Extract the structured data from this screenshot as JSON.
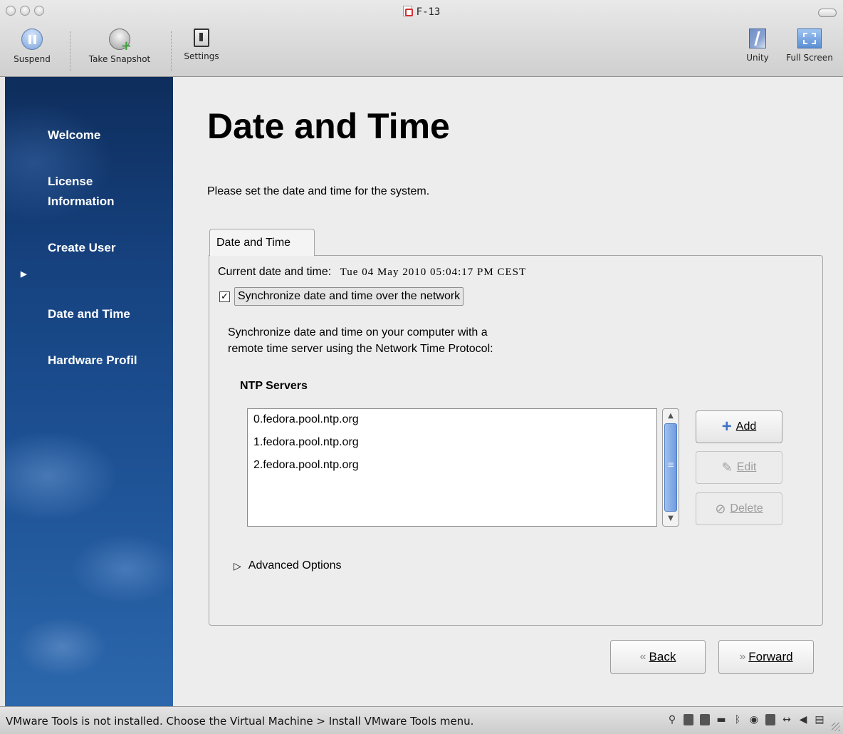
{
  "window": {
    "title": "F-13"
  },
  "toolbar": {
    "suspend_label": "Suspend",
    "snapshot_label": "Take Snapshot",
    "settings_label": "Settings",
    "unity_label": "Unity",
    "fullscreen_label": "Full Screen"
  },
  "sidebar": {
    "items": [
      {
        "label": "Welcome",
        "current": false
      },
      {
        "label": "License\nInformation",
        "current": false
      },
      {
        "label": "Create User",
        "current": false
      },
      {
        "label": "Date and Time",
        "current": true
      },
      {
        "label": "Hardware Profil",
        "current": false
      }
    ]
  },
  "main": {
    "title": "Date and Time",
    "description": "Please set the date and time for the system.",
    "tab_label": "Date and Time",
    "current_label": "Current date and time:",
    "current_value": "Tue 04 May 2010 05:04:17 PM CEST",
    "sync_checked": true,
    "sync_label": "Synchronize date and time over the network",
    "sync_description": "Synchronize date and time on your computer with a\nremote time server using the Network Time Protocol:",
    "ntp_heading": "NTP Servers",
    "ntp_servers": [
      "0.fedora.pool.ntp.org",
      "1.fedora.pool.ntp.org",
      "2.fedora.pool.ntp.org"
    ],
    "add_label": "Add",
    "edit_label": "Edit",
    "delete_label": "Delete",
    "advanced_label": "Advanced Options",
    "back_label": "Back",
    "forward_label": "Forward"
  },
  "statusbar": {
    "message": "VMware Tools is not installed. Choose the Virtual Machine > Install VMware Tools menu."
  },
  "colors": {
    "sidebar_top": "#0e2d5c",
    "sidebar_bottom": "#2c67ac",
    "accent_blue": "#3f73c4"
  }
}
